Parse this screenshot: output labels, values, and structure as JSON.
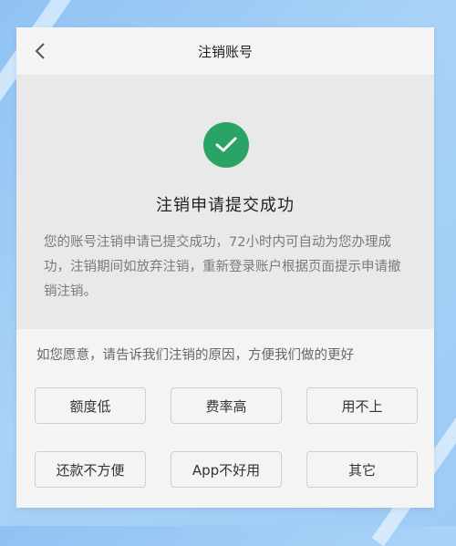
{
  "nav": {
    "title": "注销账号"
  },
  "result": {
    "title": "注销申请提交成功",
    "description": "您的账号注销申请已提交成功，72小时内可自动为您办理成功，注销期间如放弃注销，重新登录账户根据页面提示申请撤销注销。"
  },
  "survey": {
    "prompt": "如您愿意，请告诉我们注销的原因，方便我们做的更好",
    "options": [
      "额度低",
      "费率高",
      "用不上",
      "还款不方便",
      "App不好用",
      "其它"
    ]
  },
  "colors": {
    "success": "#2aa366",
    "panel": "#e9e9e9",
    "card": "#f4f4f4"
  }
}
